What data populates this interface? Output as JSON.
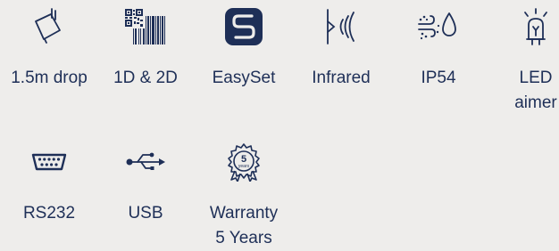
{
  "features": [
    {
      "icon": "drop-icon",
      "label": "1.5m drop"
    },
    {
      "icon": "barcode-qr-icon",
      "label": "1D & 2D"
    },
    {
      "icon": "easyset-logo-icon",
      "label": "EasySet"
    },
    {
      "icon": "infrared-icon",
      "label": "Infrared"
    },
    {
      "icon": "ip54-dust-water-icon",
      "label": "IP54"
    },
    {
      "icon": "led-aimer-icon",
      "label": "LED\naimer"
    },
    {
      "icon": "serial-port-icon",
      "label": "RS232"
    },
    {
      "icon": "usb-icon",
      "label": "USB"
    },
    {
      "icon": "warranty-badge-icon",
      "label": "Warranty\n5 Years",
      "badge_text": "5",
      "badge_subtext": "years"
    }
  ],
  "colors": {
    "background": "#eeedeb",
    "text": "#1e2f57",
    "icon": "#1e2f57"
  }
}
